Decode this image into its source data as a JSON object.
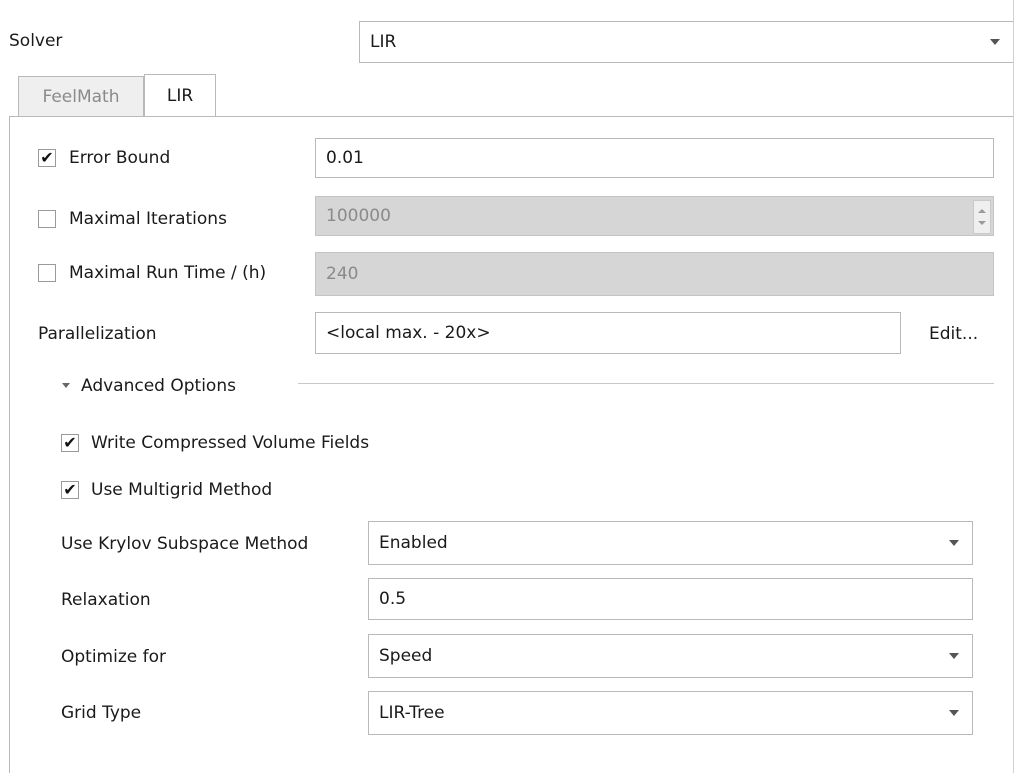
{
  "solver": {
    "label": "Solver",
    "value": "LIR"
  },
  "tabs": [
    {
      "label": "FeelMath",
      "active": false
    },
    {
      "label": "LIR",
      "active": true
    }
  ],
  "error_bound": {
    "label": "Error Bound",
    "checked": true,
    "value": "0.01"
  },
  "max_iterations": {
    "label": "Maximal Iterations",
    "checked": false,
    "value": "100000"
  },
  "max_runtime": {
    "label": "Maximal Run Time / (h)",
    "checked": false,
    "value": "240"
  },
  "parallelization": {
    "label": "Parallelization",
    "value": "<local max. - 20x>",
    "edit_label": "Edit..."
  },
  "advanced": {
    "title": "Advanced Options",
    "write_compressed": {
      "label": "Write Compressed Volume Fields",
      "checked": true
    },
    "multigrid": {
      "label": "Use Multigrid Method",
      "checked": true
    },
    "krylov": {
      "label": "Use Krylov Subspace Method",
      "value": "Enabled"
    },
    "relaxation": {
      "label": "Relaxation",
      "value": "0.5"
    },
    "optimize": {
      "label": "Optimize for",
      "value": "Speed"
    },
    "grid_type": {
      "label": "Grid Type",
      "value": "LIR-Tree"
    }
  },
  "colors": {
    "border": "#b9b9b9",
    "disabled_bg": "#d6d6d6",
    "disabled_text": "#8a8a8a",
    "inactive_tab_bg": "#efefef"
  },
  "icons": {
    "checkmark": "check-icon",
    "dropdown": "chevron-down-icon",
    "collapse": "triangle-down-icon",
    "spin": "spin-arrows-icon"
  }
}
